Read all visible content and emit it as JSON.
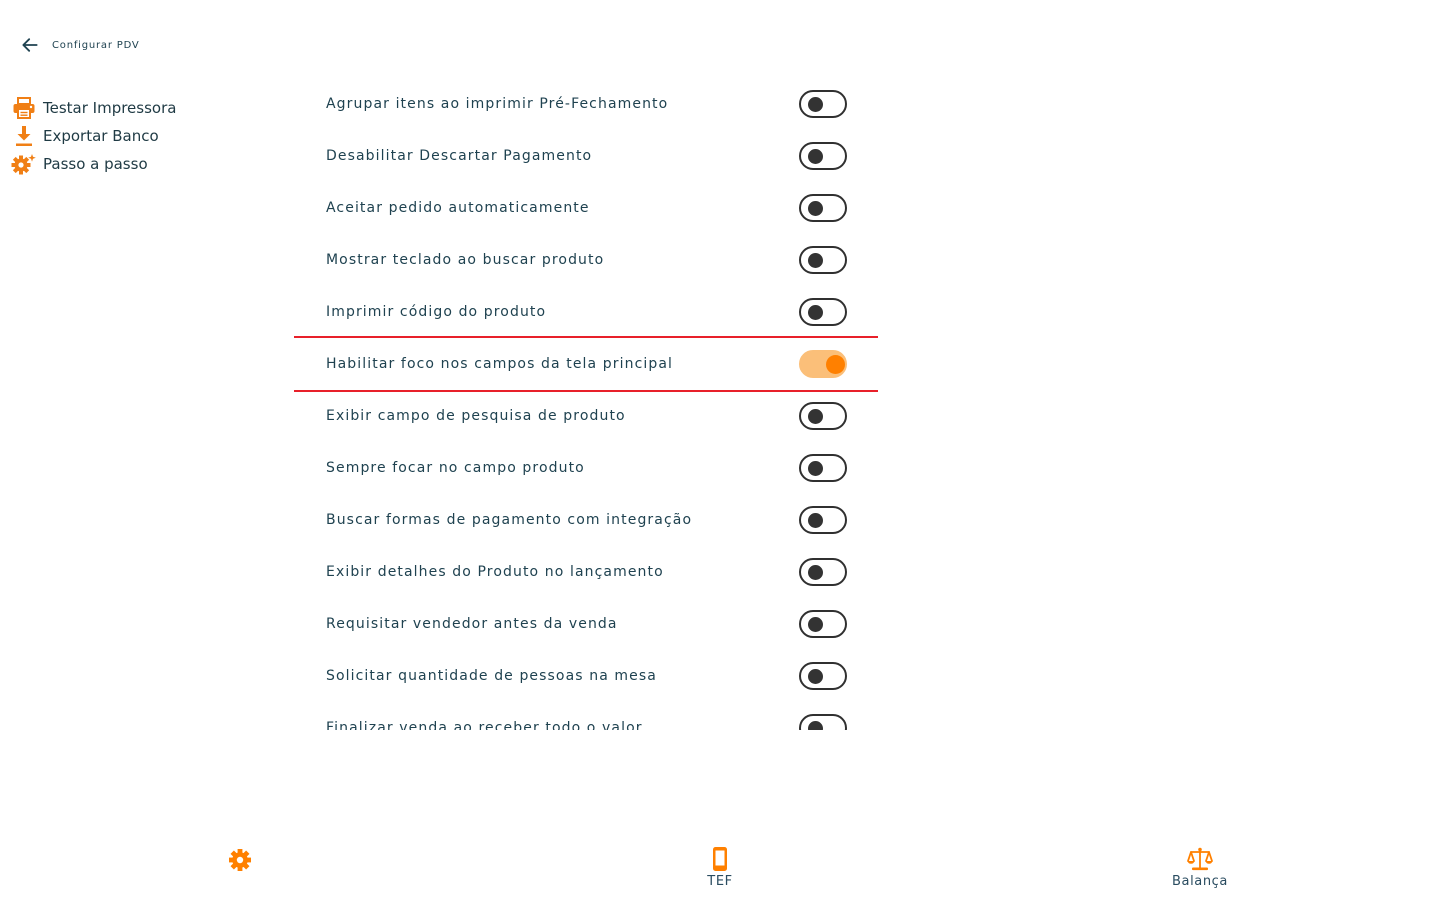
{
  "header": {
    "title": "Configurar PDV"
  },
  "side_menu": {
    "items": [
      {
        "label": "Testar Impressora",
        "icon": "printer-icon"
      },
      {
        "label": "Exportar Banco",
        "icon": "download-icon"
      },
      {
        "label": "Passo a passo",
        "icon": "gear-sparkle-icon"
      }
    ]
  },
  "settings": [
    {
      "label": "Agrupar itens ao imprimir Pré-Fechamento",
      "enabled": false
    },
    {
      "label": "Desabilitar Descartar Pagamento",
      "enabled": false
    },
    {
      "label": "Aceitar pedido automaticamente",
      "enabled": false
    },
    {
      "label": "Mostrar teclado ao buscar produto",
      "enabled": false
    },
    {
      "label": "Imprimir código do produto",
      "enabled": false
    },
    {
      "label": "Habilitar foco nos campos da tela principal",
      "enabled": true
    },
    {
      "label": "Exibir campo de pesquisa de produto",
      "enabled": false
    },
    {
      "label": "Sempre focar no campo produto",
      "enabled": false
    },
    {
      "label": "Buscar formas de pagamento com integração",
      "enabled": false
    },
    {
      "label": "Exibir detalhes do Produto no lançamento",
      "enabled": false
    },
    {
      "label": "Requisitar vendedor antes da venda",
      "enabled": false
    },
    {
      "label": "Solicitar quantidade de pessoas na mesa",
      "enabled": false
    },
    {
      "label": "Finalizar venda ao receber todo o valor",
      "enabled": false
    }
  ],
  "bottom_nav": [
    {
      "label": "",
      "icon": "gear-icon",
      "active": true
    },
    {
      "label": "TEF",
      "icon": "smartphone-icon",
      "active": false
    },
    {
      "label": "Balança",
      "icon": "scale-icon",
      "active": false
    }
  ],
  "colors": {
    "accent": "#ff8000",
    "accent_light": "#fbbf79",
    "text": "#1f4250",
    "highlight_border": "#e8202a"
  }
}
